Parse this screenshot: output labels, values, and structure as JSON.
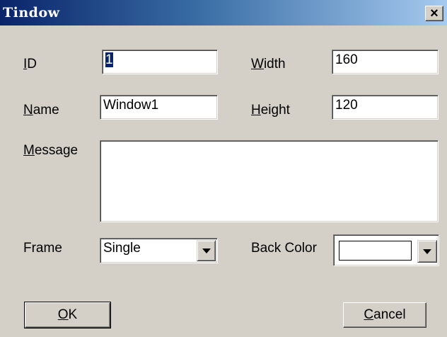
{
  "window": {
    "title": "Tindow",
    "close_glyph": "×"
  },
  "fields": {
    "id": {
      "label_key": "I",
      "label_rest": "D",
      "value": "1"
    },
    "width": {
      "label_key": "W",
      "label_rest": "idth",
      "value": "160"
    },
    "name": {
      "label_key": "N",
      "label_rest": "ame",
      "value": "Window1"
    },
    "height": {
      "label_key": "H",
      "label_rest": "eight",
      "value": "120"
    },
    "message": {
      "label_key": "M",
      "label_rest": "essage",
      "value": ""
    },
    "frame": {
      "label": "Frame",
      "selected": "Single"
    },
    "back_color": {
      "label": "Back Color",
      "selected_color": "#ffffff"
    }
  },
  "buttons": {
    "ok": {
      "label_key": "O",
      "label_rest": "K"
    },
    "cancel": {
      "label_key": "C",
      "label_rest": "ancel"
    }
  },
  "icons": {
    "dropdown": "chevron-down-icon",
    "close": "close-icon"
  },
  "colors": {
    "dialog_bg": "#d4d0c8",
    "title_start": "#0a246a",
    "title_end": "#a6caf0",
    "selection": "#0a246a"
  }
}
